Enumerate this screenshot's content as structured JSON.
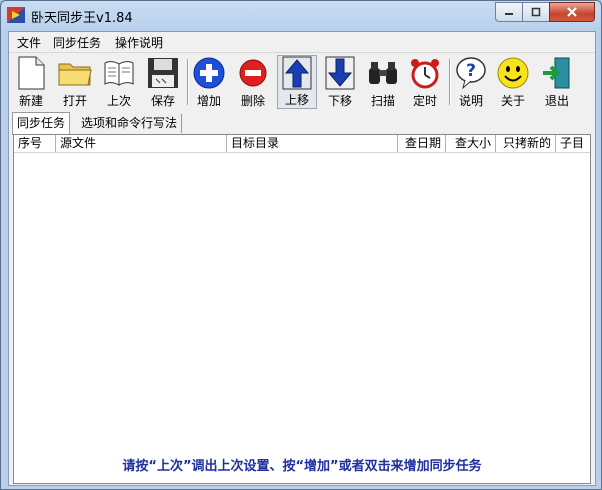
{
  "window": {
    "title": "卧天同步王v1.84"
  },
  "menu": [
    "文件",
    "同步任务",
    "操作说明"
  ],
  "toolbar": {
    "new": "新建",
    "open": "打开",
    "last": "上次",
    "save": "保存",
    "add": "增加",
    "delete": "删除",
    "move_up": "上移",
    "move_down": "下移",
    "scan": "扫描",
    "timer": "定时",
    "help": "说明",
    "about": "关于",
    "exit": "退出"
  },
  "tabs": [
    "同步任务",
    "选项和命令行写法"
  ],
  "table": {
    "columns": [
      "序号",
      "源文件",
      "目标目录",
      "查日期",
      "查大小",
      "只拷新的",
      "子目"
    ]
  },
  "hint": "请按“上次”调出上次设置、按“增加”或者双击来增加同步任务",
  "colors": {
    "accent": "#1f2fa0",
    "titlebar": "#b8d0ec"
  }
}
